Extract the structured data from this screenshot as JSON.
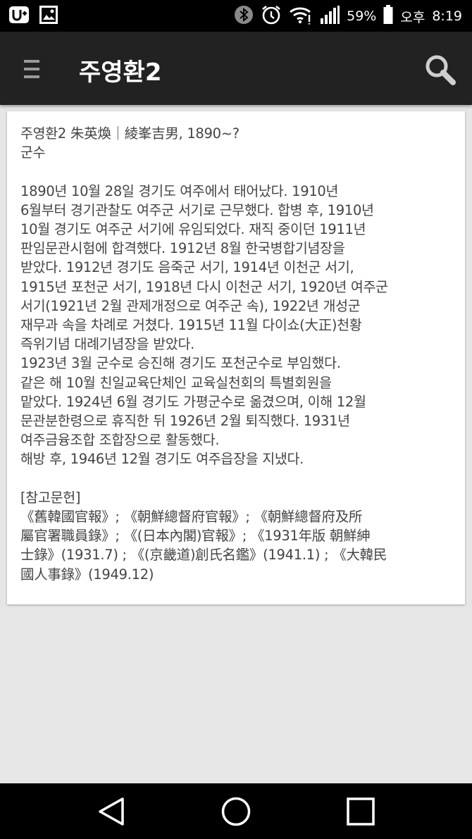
{
  "status_bar": {
    "battery_percent": "59%",
    "ampm": "오후",
    "time": "8:19",
    "icons": [
      "u-plus-icon",
      "gallery-icon",
      "bluetooth-icon",
      "alarm-icon",
      "wifi-icon",
      "signal-icon",
      "battery-icon"
    ]
  },
  "app_bar": {
    "title": "주영환2",
    "icons": [
      "menu-icon",
      "search-icon"
    ]
  },
  "article": {
    "heading": "주영환2 朱英煥｜綾峯吉男, 1890~?",
    "subtitle": "군수",
    "body_lines": [
      "1890년 10월 28일 경기도 여주에서 태어났다. 1910년",
      "6월부터 경기관찰도 여주군 서기로 근무했다. 합병 후, 1910년",
      "10월 경기도 여주군 서기에 유임되었다. 재직 중이던 1911년",
      "판임문관시험에 합격했다. 1912년 8월 한국병합기념장을",
      "받았다. 1912년 경기도 음죽군 서기, 1914년 이천군 서기,",
      "1915년 포천군 서기, 1918년 다시 이천군 서기, 1920년 여주군",
      "서기(1921년 2월 관제개정으로 여주군 속), 1922년 개성군",
      "재무과 속을 차례로 거쳤다. 1915년 11월 다이쇼(大正)천황",
      "즉위기념 대례기념장을 받았다.",
      "1923년 3월 군수로 승진해 경기도 포천군수로 부임했다.",
      "같은 해 10월 친일교육단체인 교육실천회의 특별회원을",
      "맡았다. 1924년 6월 경기도 가평군수로 옮겼으며, 이해 12월",
      "문관분한령으로 휴직한 뒤 1926년 2월 퇴직했다. 1931년",
      "여주금융조합 조합장으로 활동했다.",
      "해방 후, 1946년 12월 경기도 여주읍장을 지냈다."
    ],
    "references_label": "[참고문헌]",
    "reference_lines": [
      "《舊韓國官報》; 《朝鮮總督府官報》; 《朝鮮總督府及所",
      "屬官署職員錄》; 《(日本內閣)官報》; 《1931年版 朝鮮紳",
      "士錄》(1931.7) ; 《(京畿道)創氏名鑑》(1941.1) ; 《大韓民",
      "國人事錄》(1949.12)"
    ]
  },
  "nav_bar": {
    "icons": [
      "back-icon",
      "home-icon",
      "recent-apps-icon"
    ]
  },
  "colors": {
    "status_bar": "#000000",
    "app_bar": "#222222",
    "background": "#e6e6e6",
    "card": "#ffffff",
    "body_text": "#444444",
    "nav_bar": "#000000"
  }
}
